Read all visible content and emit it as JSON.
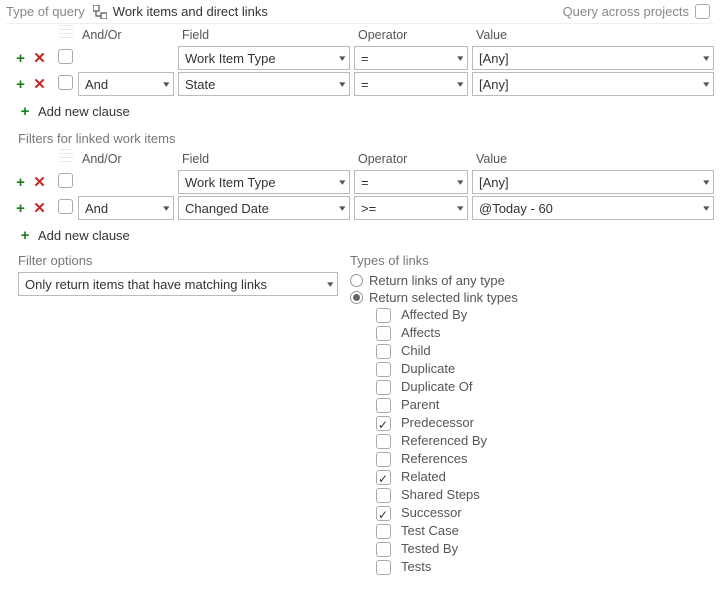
{
  "top": {
    "type_label": "Type of query",
    "query_type": "Work items and direct links",
    "cross_label": "Query across projects",
    "cross_checked": false
  },
  "columns": {
    "andor": "And/Or",
    "field": "Field",
    "operator": "Operator",
    "value": "Value"
  },
  "main_clauses": [
    {
      "andor": "",
      "field": "Work Item Type",
      "operator": "=",
      "value": "[Any]"
    },
    {
      "andor": "And",
      "field": "State",
      "operator": "=",
      "value": "[Any]"
    }
  ],
  "linked_label": "Filters for linked work items",
  "linked_clauses": [
    {
      "andor": "",
      "field": "Work Item Type",
      "operator": "=",
      "value": "[Any]"
    },
    {
      "andor": "And",
      "field": "Changed Date",
      "operator": ">=",
      "value": "@Today - 60"
    }
  ],
  "add_clause_label": "Add new clause",
  "filter_options": {
    "label": "Filter options",
    "selected": "Only return items that have matching links"
  },
  "links_section": {
    "label": "Types of links",
    "radio_any": "Return links of any type",
    "radio_selected": "Return selected link types",
    "radio_value": "selected",
    "types": [
      {
        "label": "Affected By",
        "checked": false
      },
      {
        "label": "Affects",
        "checked": false
      },
      {
        "label": "Child",
        "checked": false
      },
      {
        "label": "Duplicate",
        "checked": false
      },
      {
        "label": "Duplicate Of",
        "checked": false
      },
      {
        "label": "Parent",
        "checked": false
      },
      {
        "label": "Predecessor",
        "checked": true
      },
      {
        "label": "Referenced By",
        "checked": false
      },
      {
        "label": "References",
        "checked": false
      },
      {
        "label": "Related",
        "checked": true
      },
      {
        "label": "Shared Steps",
        "checked": false
      },
      {
        "label": "Successor",
        "checked": true
      },
      {
        "label": "Test Case",
        "checked": false
      },
      {
        "label": "Tested By",
        "checked": false
      },
      {
        "label": "Tests",
        "checked": false
      }
    ]
  }
}
